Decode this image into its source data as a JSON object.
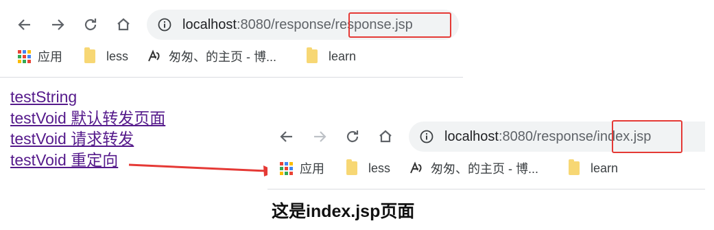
{
  "window1": {
    "url_host": "localhost",
    "url_path_dim": ":8080/response",
    "url_path_highlight": "/response.jsp"
  },
  "window2": {
    "url_host": "localhost",
    "url_path_dim": ":8080/response",
    "url_path_highlight": "/index.jsp"
  },
  "bookmarks": {
    "apps": "应用",
    "less": "less",
    "blog": "匆匆、的主页 - 博...",
    "learn": "learn"
  },
  "links": [
    "testString",
    "testVoid 默认转发页面",
    "testVoid 请求转发",
    "testVoid 重定向"
  ],
  "caption": "这是index.jsp页面",
  "colors": {
    "highlight": "#e53935",
    "link": "#551a8b",
    "omnibox": "#f1f3f4",
    "arrow": "#e53935"
  },
  "icons": [
    "back-arrow-icon",
    "forward-arrow-icon",
    "reload-icon",
    "home-icon",
    "info-icon",
    "apps-grid-icon",
    "folder-icon",
    "blog-favicon-icon"
  ]
}
